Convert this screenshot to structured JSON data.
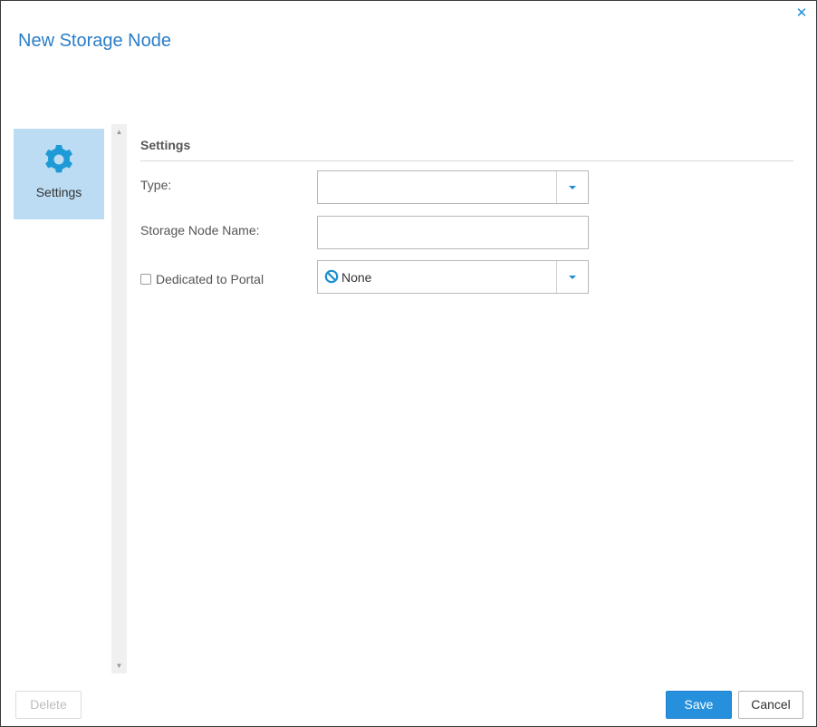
{
  "dialog": {
    "title": "New Storage Node",
    "close_icon": "close-icon"
  },
  "nav": {
    "items": [
      {
        "label": "Settings",
        "icon": "gear-icon",
        "selected": true
      }
    ]
  },
  "form": {
    "section_title": "Settings",
    "type": {
      "label": "Type:",
      "value": ""
    },
    "storage_node_name": {
      "label": "Storage Node Name:",
      "value": ""
    },
    "dedicated_to_portal": {
      "label": "Dedicated to Portal",
      "checked": false
    },
    "portal": {
      "value": "None",
      "icon": "none-icon"
    }
  },
  "footer": {
    "delete_label": "Delete",
    "save_label": "Save",
    "cancel_label": "Cancel"
  },
  "colors": {
    "accent": "#2790dc",
    "title": "#2a7ec7",
    "nav_selected": "#bcdcf3"
  }
}
